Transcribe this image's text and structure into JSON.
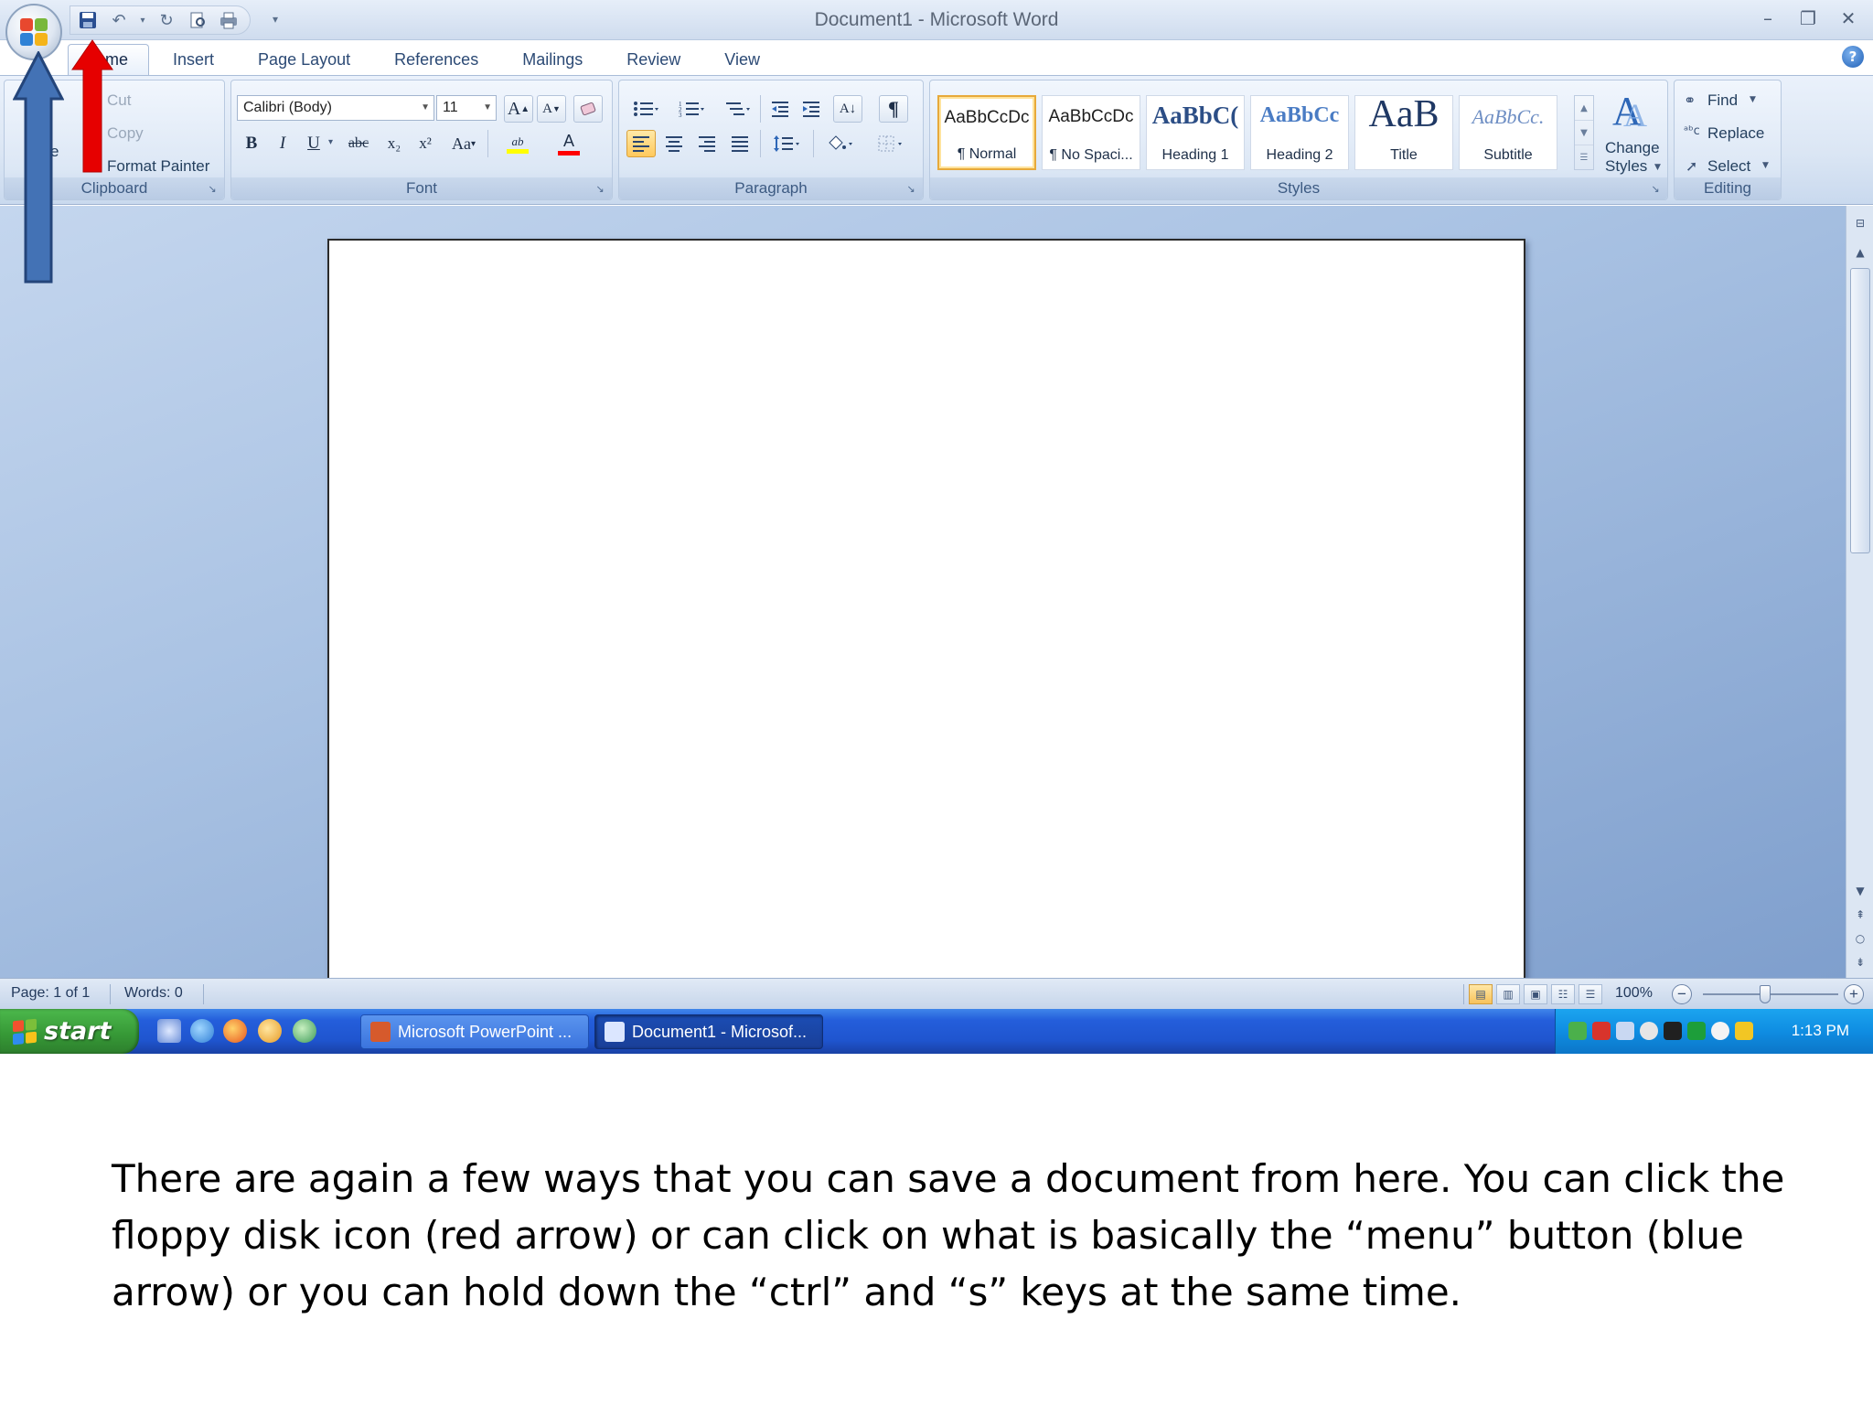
{
  "window": {
    "title": "Document1 - Microsoft Word",
    "controls": [
      "minimize",
      "restore",
      "close"
    ]
  },
  "qat": {
    "icons": [
      "save-icon",
      "undo-icon",
      "redo-icon",
      "print-preview-icon",
      "quick-print-icon",
      "customize-qat-icon"
    ]
  },
  "tabs": [
    {
      "label": "Home",
      "shown": "me",
      "active": true
    },
    {
      "label": "Insert"
    },
    {
      "label": "Page Layout"
    },
    {
      "label": "References"
    },
    {
      "label": "Mailings"
    },
    {
      "label": "Review"
    },
    {
      "label": "View"
    }
  ],
  "clipboard": {
    "group_label": "Clipboard",
    "paste_partial": "e",
    "cut": "Cut",
    "copy": "Copy",
    "format_painter": "Format Painter"
  },
  "font": {
    "group_label": "Font",
    "font_name": "Calibri (Body)",
    "font_size": "11",
    "bold": "B",
    "italic": "I",
    "underline": "U",
    "strike": "abc",
    "subscript": "x₂",
    "superscript": "x²",
    "change_case": "Aa",
    "grow": "A",
    "shrink": "A",
    "highlight": "ab",
    "font_color": "A"
  },
  "paragraph": {
    "group_label": "Paragraph",
    "sort": "A↓",
    "show_marks": "¶"
  },
  "styles": {
    "group_label": "Styles",
    "items": [
      {
        "sample": "AaBbCcDc",
        "name": "¶ Normal",
        "selected": true
      },
      {
        "sample": "AaBbCcDc",
        "name": "¶ No Spaci..."
      },
      {
        "sample": "AaBbC(",
        "name": "Heading 1"
      },
      {
        "sample": "AaBbCc",
        "name": "Heading 2"
      },
      {
        "sample": "AaB",
        "name": "Title"
      },
      {
        "sample": "AaBbCc.",
        "name": "Subtitle"
      }
    ],
    "change_styles_line1": "Change",
    "change_styles_line2": "Styles"
  },
  "editing": {
    "group_label": "Editing",
    "find": "Find",
    "replace": "Replace",
    "select": "Select"
  },
  "status": {
    "page": "Page: 1 of 1",
    "words": "Words: 0",
    "zoom": "100%",
    "zoom_level_percent": 100
  },
  "taskbar": {
    "start": "start",
    "tasks": [
      {
        "label": "Microsoft PowerPoint ..."
      },
      {
        "label": "Document1 - Microsof..."
      }
    ],
    "clock": "1:13 PM"
  },
  "annotations": {
    "red_arrow_target": "save-icon",
    "blue_arrow_target": "office-button"
  },
  "colors": {
    "red_arrow": "#e60000",
    "blue_arrow": "#4372b5",
    "ribbon": "#dbe6f4",
    "workspace": "#a9c2e3",
    "taskbar": "#245edb",
    "start": "#379a37"
  },
  "caption": {
    "text": "There are again a few ways that you can save a document from here. You can click the floppy disk icon (red arrow) or can click on what is basically the “menu” button (blue arrow) or you can hold down the “ctrl” and “s” keys at the same time."
  }
}
